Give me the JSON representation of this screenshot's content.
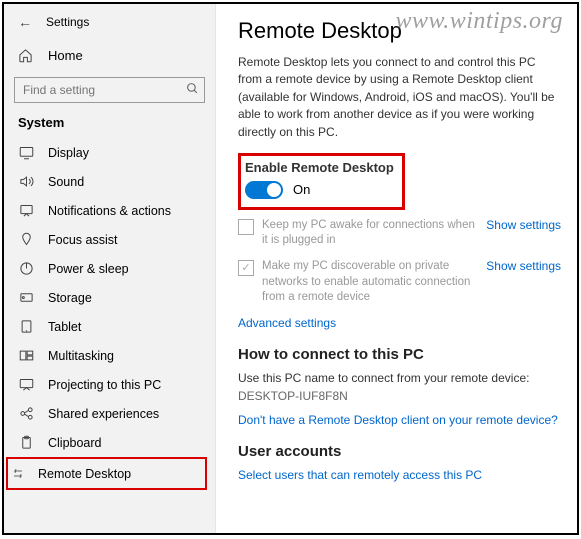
{
  "watermark": "www.wintips.org",
  "header": {
    "back": "←",
    "title": "Settings"
  },
  "home": {
    "label": "Home"
  },
  "search": {
    "placeholder": "Find a setting"
  },
  "section_title": "System",
  "nav": {
    "display": "Display",
    "sound": "Sound",
    "notifications": "Notifications & actions",
    "focus": "Focus assist",
    "power": "Power & sleep",
    "storage": "Storage",
    "tablet": "Tablet",
    "multitasking": "Multitasking",
    "projecting": "Projecting to this PC",
    "shared": "Shared experiences",
    "clipboard": "Clipboard",
    "remote": "Remote Desktop"
  },
  "main": {
    "title": "Remote Desktop",
    "desc": "Remote Desktop lets you connect to and control this PC from a remote device by using a Remote Desktop client (available for Windows, Android, iOS and macOS). You'll be able to work from another device as if you were working directly on this PC.",
    "enable": {
      "title": "Enable Remote Desktop",
      "state": "On"
    },
    "opt1": "Keep my PC awake for connections when it is plugged in",
    "opt2": "Make my PC discoverable on private networks to enable automatic connection from a remote device",
    "show_settings": "Show settings",
    "advanced": "Advanced settings",
    "howto_title": "How to connect to this PC",
    "howto_text": "Use this PC name to connect from your remote device:",
    "pcname": "DESKTOP-IUF8F8N",
    "howto_link": "Don't have a Remote Desktop client on your remote device?",
    "users_title": "User accounts",
    "users_link": "Select users that can remotely access this PC"
  }
}
